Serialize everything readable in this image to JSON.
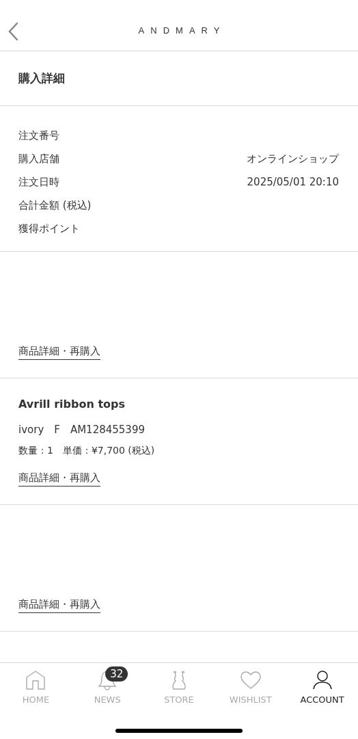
{
  "header": {
    "logo": "ANDMARY"
  },
  "page_title": "購入詳細",
  "order_info": [
    {
      "label": "注文番号"
    },
    {
      "label": "購入店舗",
      "value": "オンラインショップ"
    },
    {
      "label": "注文日時",
      "value": "2025/05/01 20:10"
    },
    {
      "label": "合計金額 (税込)"
    },
    {
      "label": "獲得ポイント"
    }
  ],
  "items": [
    {
      "link": "商品詳細・再購入"
    },
    {
      "name": "Avrill ribbon tops",
      "variant": "ivory　F　AM128455399",
      "quantity": "数量：1　単価：¥7,700 (税込)",
      "link": "商品詳細・再購入"
    },
    {
      "link": "商品詳細・再購入"
    }
  ],
  "tab_bar": [
    {
      "kind": "home",
      "label": "HOME",
      "selected": false
    },
    {
      "kind": "news",
      "label": "NEWS",
      "selected": false,
      "badge": "32"
    },
    {
      "kind": "store",
      "label": "STORE",
      "selected": false
    },
    {
      "kind": "wishlist",
      "label": "WISHLIST",
      "selected": false
    },
    {
      "kind": "account",
      "label": "ACCOUNT",
      "selected": true
    }
  ]
}
